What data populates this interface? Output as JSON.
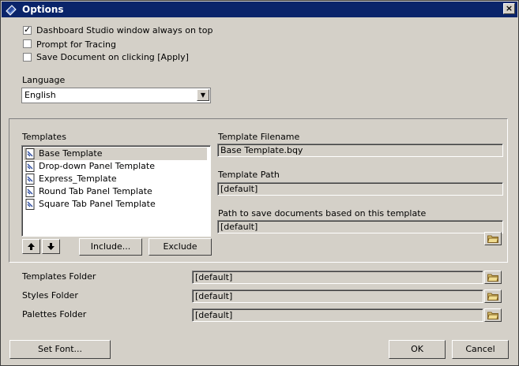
{
  "window": {
    "title": "Options",
    "icon": "options-app-icon"
  },
  "checkboxes": [
    {
      "label": "Dashboard Studio window always on top",
      "checked": true
    },
    {
      "label": "Prompt for Tracing",
      "checked": false
    },
    {
      "label": "Save Document on clicking [Apply]",
      "checked": false
    }
  ],
  "language": {
    "label": "Language",
    "value": "English"
  },
  "templates": {
    "label": "Templates",
    "items": [
      {
        "label": "Base Template",
        "selected": true
      },
      {
        "label": "Drop-down Panel Template",
        "selected": false
      },
      {
        "label": "Express_Template",
        "selected": false
      },
      {
        "label": "Round Tab Panel Template",
        "selected": false
      },
      {
        "label": "Square Tab Panel Template",
        "selected": false
      }
    ],
    "include_label": "Include...",
    "exclude_label": "Exclude",
    "filename_label": "Template Filename",
    "filename_value": "Base Template.bqy",
    "path_label": "Template Path",
    "path_value": "[default]",
    "save_path_label": "Path to save documents based on this template",
    "save_path_value": "[default]"
  },
  "folders": [
    {
      "label": "Templates Folder",
      "value": "[default]"
    },
    {
      "label": "Styles Folder",
      "value": "[default]"
    },
    {
      "label": "Palettes Folder",
      "value": "[default]"
    }
  ],
  "footer": {
    "set_font_label": "Set Font...",
    "ok_label": "OK",
    "cancel_label": "Cancel"
  }
}
